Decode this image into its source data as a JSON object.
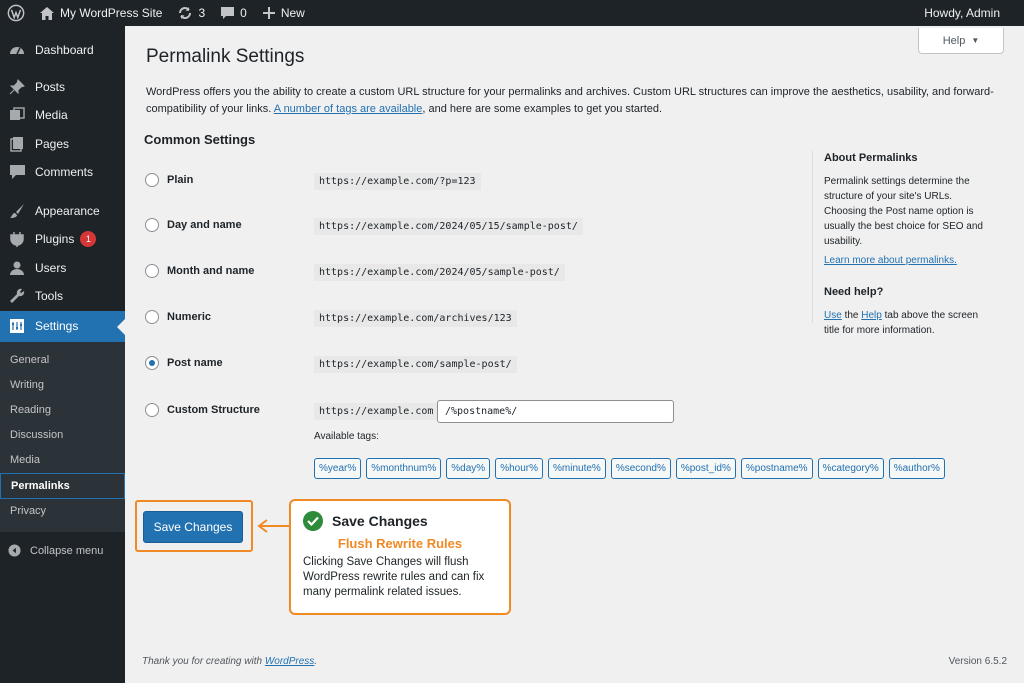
{
  "adminbar": {
    "site_name": "My WordPress Site",
    "updates_count": "3",
    "comments_count": "0",
    "new_label": "New",
    "howdy": "Howdy, Admin"
  },
  "sidebar": {
    "items": [
      {
        "label": "Dashboard",
        "icon": "dashboard-icon"
      },
      {
        "label": "Posts",
        "icon": "pin-icon"
      },
      {
        "label": "Media",
        "icon": "media-icon"
      },
      {
        "label": "Pages",
        "icon": "pages-icon"
      },
      {
        "label": "Comments",
        "icon": "comment-icon"
      },
      {
        "label": "Appearance",
        "icon": "brush-icon"
      },
      {
        "label": "Plugins",
        "icon": "plugin-icon",
        "badge": "1"
      },
      {
        "label": "Users",
        "icon": "user-icon"
      },
      {
        "label": "Tools",
        "icon": "wrench-icon"
      },
      {
        "label": "Settings",
        "icon": "settings-icon"
      }
    ],
    "submenu": [
      "General",
      "Writing",
      "Reading",
      "Discussion",
      "Media",
      "Permalinks",
      "Privacy"
    ],
    "collapse": "Collapse menu"
  },
  "help_button": "Help",
  "page_title": "Permalink Settings",
  "intro": {
    "text_before": "WordPress offers you the ability to create a custom URL structure for your permalinks and archives. Custom URL structures can improve the aesthetics, usability, and forward-compatibility of your links. ",
    "link": "A number of tags are available",
    "text_after": ", and here are some examples to get you started."
  },
  "common_settings": "Common Settings",
  "options": [
    {
      "label": "Plain",
      "example": "https://example.com/?p=123",
      "checked": false
    },
    {
      "label": "Day and name",
      "example": "https://example.com/2024/05/15/sample-post/",
      "checked": false
    },
    {
      "label": "Month and name",
      "example": "https://example.com/2024/05/sample-post/",
      "checked": false
    },
    {
      "label": "Numeric",
      "example": "https://example.com/archives/123",
      "checked": false
    },
    {
      "label": "Post name",
      "example": "https://example.com/sample-post/",
      "checked": true
    },
    {
      "label": "Custom Structure",
      "example": "https://example.com",
      "checked": false
    }
  ],
  "custom_structure_value": "/%postname%/",
  "available_tags_label": "Available tags:",
  "tags": [
    "%year%",
    "%monthnum%",
    "%day%",
    "%hour%",
    "%minute%",
    "%second%",
    "%post_id%",
    "%postname%",
    "%category%",
    "%author%"
  ],
  "aside": {
    "about_title": "About Permalinks",
    "about_text": "Permalink settings determine the structure of your site's URLs. Choosing the Post name option is usually the best choice for SEO and usability.",
    "about_link": "Learn more about permalinks.",
    "help_title": "Need help?",
    "help_use": "Use",
    "help_the": " the ",
    "help_link": "Help",
    "help_rest": " tab above the screen title for more information."
  },
  "save_button": "Save Changes",
  "callout": {
    "title": "Save Changes",
    "subtitle": "Flush Rewrite Rules",
    "body": "Clicking Save Changes will flush WordPress rewrite rules and can fix many permalink related issues."
  },
  "footer": {
    "thanks_before": "Thank you for creating with ",
    "thanks_link": "WordPress",
    "thanks_after": ".",
    "version": "Version 6.5.2"
  },
  "colors": {
    "accent": "#2271b1",
    "highlight": "#f08a24",
    "sidebar": "#1d2327",
    "success": "#2e8b3a"
  }
}
